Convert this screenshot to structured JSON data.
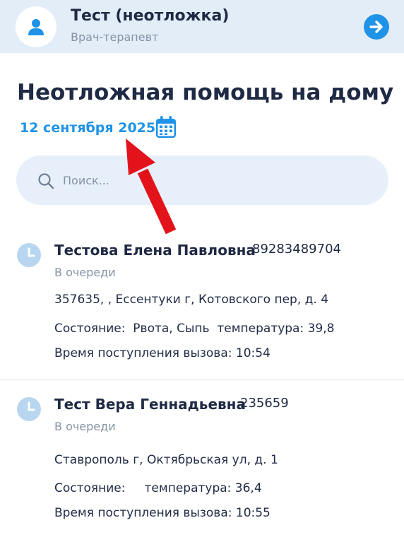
{
  "header": {
    "user_name": "Тест (неотложка)",
    "user_role": "Врач-терапевт",
    "avatar_icon": "user-icon",
    "logout_icon": "arrow-right-circle-icon"
  },
  "page": {
    "title": "Неотложная помощь на дому",
    "date": "12 сентября 2025",
    "calendar_icon": "calendar-icon"
  },
  "search": {
    "placeholder": "Поиск...",
    "value": "",
    "icon": "search-icon"
  },
  "calls": [
    {
      "name": "Тестова Елена Павловна",
      "phone": "89283489704",
      "status": "В очереди",
      "address": "357635, , Ессентуки г, Котовского пер, д. 4",
      "condition": "Состояние:  Рвота, Сыпь  температура: 39,8",
      "call_time": "Время поступления вызова: 10:54"
    },
    {
      "name": "Тест Вера Геннадьевна",
      "phone": "235659",
      "status": "В очереди",
      "address": "Ставрополь г, Октябрьская ул, д. 1",
      "condition": "Состояние:     температура: 36,4",
      "call_time": "Время поступления вызова: 10:55"
    }
  ],
  "colors": {
    "accent": "#1f93e7",
    "header_bg": "#e3edf7",
    "clock_icon": "#b8d6ef",
    "annotation_arrow": "#e3131b"
  },
  "annotation": {
    "icon": "red-arrow-annotation"
  }
}
